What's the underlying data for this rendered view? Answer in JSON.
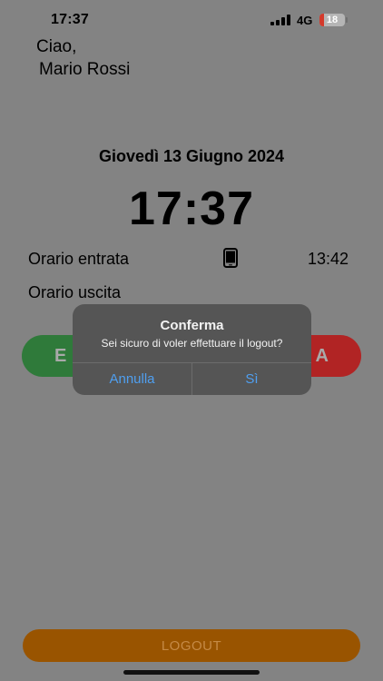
{
  "status_bar": {
    "time": "17:37",
    "network": "4G",
    "battery_level": "18",
    "battery_fraction": 0.18,
    "battery_color": "#d33a2c",
    "signal_icon": "signal-bars-icon"
  },
  "greeting": {
    "line1": "Ciao,",
    "line2": "Mario Rossi"
  },
  "date": "Giovedì 13 Giugno 2024",
  "clock": "17:37",
  "rows": {
    "entry_label": "Orario entrata",
    "entry_icon": "smartphone-icon",
    "entry_time": "13:42",
    "exit_label": "Orario uscita"
  },
  "actions": {
    "entrata_visible": "E",
    "uscita_visible": "A"
  },
  "logout_label": "LOGOUT",
  "alert": {
    "title": "Conferma",
    "message": "Sei sicuro di voler effettuare il logout?",
    "cancel_label": "Annulla",
    "confirm_label": "Sì",
    "button_color": "#4f9ff0"
  },
  "colors": {
    "overlay_background": "#838383",
    "entrata_button": "#2f7a3a",
    "uscita_button": "#b12424",
    "logout_button": "#995400"
  }
}
